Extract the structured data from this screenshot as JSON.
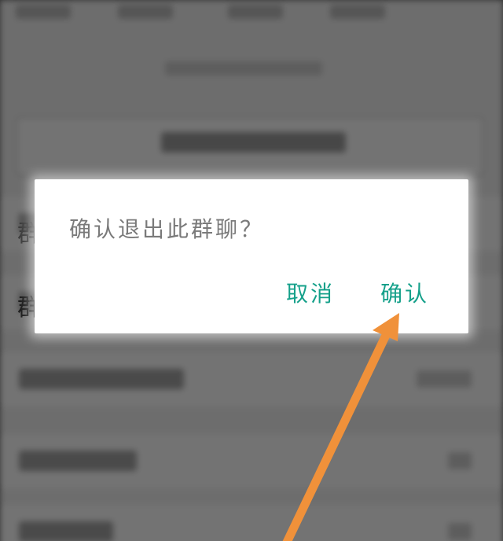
{
  "background": {
    "partial_glyph_1": "群",
    "partial_glyph_2": "群"
  },
  "dialog": {
    "message": "确认退出此群聊？",
    "cancel_label": "取消",
    "confirm_label": "确认"
  },
  "colors": {
    "accent": "#15a08a",
    "annotation_arrow": "#f0913a"
  }
}
